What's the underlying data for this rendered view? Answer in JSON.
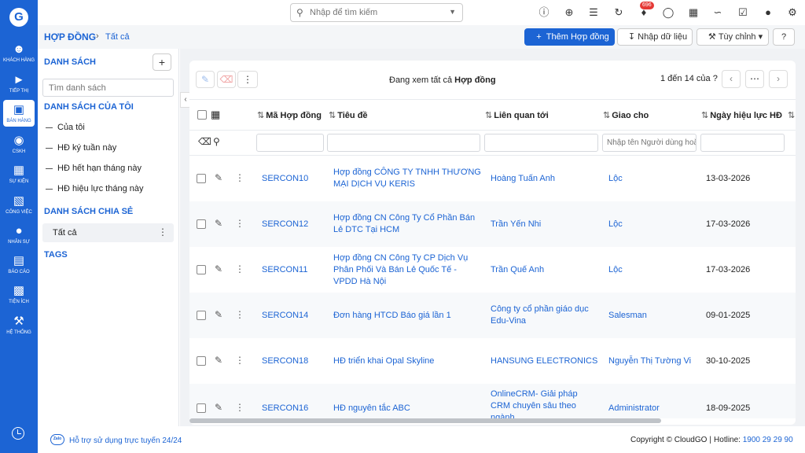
{
  "rail": {
    "logo": "G",
    "items": [
      {
        "label": "Khách hàng",
        "icon": "users-icon"
      },
      {
        "label": "Tiếp thị",
        "icon": "megaphone-icon"
      },
      {
        "label": "Bán hàng",
        "icon": "cart-icon"
      },
      {
        "label": "CSKH",
        "icon": "support-icon"
      },
      {
        "label": "Sự kiện",
        "icon": "calendar-icon"
      },
      {
        "label": "Công việc",
        "icon": "briefcase-icon"
      },
      {
        "label": "Nhân sự",
        "icon": "person-icon"
      },
      {
        "label": "Báo cáo",
        "icon": "report-icon"
      },
      {
        "label": "Tiện ích",
        "icon": "tools-icon"
      },
      {
        "label": "Hệ thống",
        "icon": "wrench-icon"
      }
    ],
    "active_index": 2
  },
  "topbar": {
    "search_placeholder": "Nhập để tìm kiếm",
    "notification_count": "696"
  },
  "header": {
    "module": "HỢP ĐỒNG",
    "breadcrumb": "Tất cả",
    "add_button": "Thêm Hợp đồng",
    "import_button": "Nhập dữ liệu",
    "customize_button": "Tùy chỉnh"
  },
  "sidebar": {
    "section_lists": "DANH SÁCH",
    "filter_placeholder": "Tìm danh sách",
    "section_my_lists": "DANH SÁCH CỦA TÔI",
    "my_lists": [
      "Của tôi",
      "HĐ ký tuần này",
      "HĐ hết hạn tháng này",
      "HĐ hiệu lực tháng này"
    ],
    "section_shared": "DANH SÁCH CHIA SẺ",
    "shared_lists": [
      "Tất cả"
    ],
    "section_tags": "TAGS"
  },
  "list_view": {
    "viewing_prefix": "Đang xem tất cả",
    "viewing_module": "Hợp đồng",
    "pagination": "1 đến 14 của",
    "pagination_unknown": "?",
    "columns": [
      "Mã Hợp đồng",
      "Tiêu đề",
      "Liên quan tới",
      "Giao cho",
      "Ngày hiệu lực HĐ"
    ],
    "assignee_filter_placeholder": "Nhập tên Người dùng hoặc Nhóm",
    "rows": [
      {
        "code": "SERCON10",
        "title": "Hợp đồng CÔNG TY TNHH THƯƠNG MẠI DỊCH VỤ KERIS",
        "related": "Hoàng Tuấn Anh",
        "assignee": "Lộc",
        "effective": "13-03-2026"
      },
      {
        "code": "SERCON12",
        "title": "Hợp đồng CN Công Ty Cổ Phần Bán Lẻ DTC Tại HCM",
        "related": "Trần Yến Nhi",
        "assignee": "Lộc",
        "effective": "17-03-2026"
      },
      {
        "code": "SERCON11",
        "title": "Hợp đồng CN Công Ty CP Dịch Vụ Phân Phối Và Bán Lẻ Quốc Tế - VPDD Hà Nội",
        "related": "Trần Quế Anh",
        "assignee": "Lộc",
        "effective": "17-03-2026"
      },
      {
        "code": "SERCON14",
        "title": "Đơn hàng HTCD Báo giá lần 1",
        "related": "Công ty cổ phần giáo dục Edu-Vina",
        "assignee": "Salesman",
        "effective": "09-01-2025"
      },
      {
        "code": "SERCON18",
        "title": "HĐ triển khai Opal Skyline",
        "related": "HANSUNG ELECTRONICS",
        "assignee": "Nguyễn Thị Tường Vi",
        "effective": "30-10-2025"
      },
      {
        "code": "SERCON16",
        "title": "HĐ nguyên tắc ABC",
        "related": "OnlineCRM- Giải pháp CRM chuyên sâu theo ngành",
        "assignee": "Administrator",
        "effective": "18-09-2025"
      }
    ]
  },
  "footer": {
    "zalo_label": "Zalo",
    "support": "Hỗ trợ sử dụng trực tuyến 24/24",
    "copyright": "Copyright © CloudGO",
    "hotline_label": "Hotline:",
    "hotline": "1900 29 29 90"
  },
  "colors": {
    "brand": "#1c64d4",
    "badge": "#e53935"
  }
}
